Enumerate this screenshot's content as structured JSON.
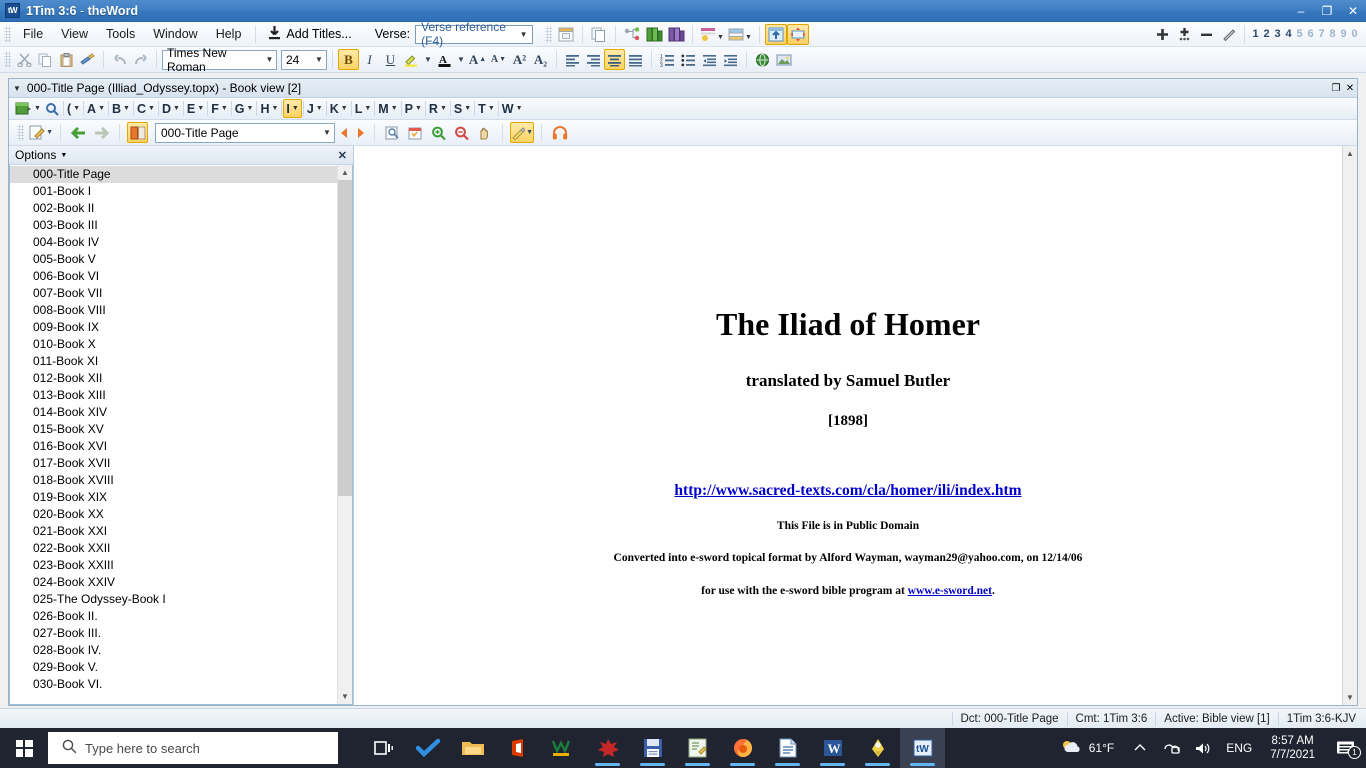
{
  "window": {
    "app_icon": "tW",
    "title_ref": "1Tim 3:6",
    "title_sep": " - ",
    "title_app": "theWord",
    "minimize": "–",
    "maximize": "❐",
    "close": "✕"
  },
  "menubar": {
    "items": [
      "File",
      "View",
      "Tools",
      "Window",
      "Help"
    ],
    "add_titles": "Add Titles...",
    "verse_label": "Verse:",
    "verse_combo_value": "Verse reference (F4)",
    "number_buttons": [
      "1",
      "2",
      "3",
      "4",
      "5",
      "6",
      "7",
      "8",
      "9",
      "0"
    ],
    "number_buttons_active": 4
  },
  "format_toolbar": {
    "font_name": "Times New Roman",
    "font_size": "24",
    "bold": "B",
    "italic": "I",
    "underline": "U",
    "font_color_letter": "A",
    "highlight_letter": "A",
    "grow_font": "A",
    "shrink_font": "A",
    "superscript": "A²",
    "subscript": "A₂"
  },
  "child_window": {
    "title": "000-Title Page (Illiad_Odyssey.topx) - Book view [2]",
    "restore": "❐",
    "close": "✕",
    "letter_buttons": [
      "(",
      "A",
      "B",
      "C",
      "D",
      "E",
      "F",
      "G",
      "H",
      "I",
      "J",
      "K",
      "L",
      "M",
      "P",
      "R",
      "S",
      "T",
      "W"
    ],
    "letter_active": "I",
    "nav_combo_value": "000-Title Page"
  },
  "left_panel": {
    "options_label": "Options",
    "close": "✕",
    "selected_index": 0,
    "items": [
      "000-Title Page",
      "001-Book I",
      "002-Book II",
      "003-Book III",
      "004-Book IV",
      "005-Book V",
      "006-Book VI",
      "007-Book VII",
      "008-Book VIII",
      "009-Book IX",
      "010-Book X",
      "011-Book XI",
      "012-Book XII",
      "013-Book XIII",
      "014-Book XIV",
      "015-Book XV",
      "016-Book XVI",
      "017-Book XVII",
      "018-Book XVIII",
      "019-Book XIX",
      "020-Book XX",
      "021-Book XXI",
      "022-Book XXII",
      "023-Book XXIII",
      "024-Book XXIV",
      "025-The Odyssey-Book I",
      "026-Book II.",
      "027-Book III.",
      "028-Book IV.",
      "029-Book V.",
      "030-Book VI."
    ]
  },
  "document": {
    "title": "The Iliad of Homer",
    "translator": "translated by Samuel Butler",
    "year": "[1898]",
    "source_link": "http://www.sacred-texts.com/cla/homer/ili/index.htm",
    "public_domain": "This File is in Public Domain",
    "converted": "Converted into e-sword topical format by Alford Wayman,  wayman29@yahoo.com, on 12/14/06",
    "for_use_prefix": "for use with the e-sword bible program at ",
    "for_use_link": "www.e-sword.net",
    "for_use_suffix": "."
  },
  "statusbar": {
    "dct": "Dct: 000-Title Page",
    "cmt": "Cmt: 1Tim 3:6",
    "active": "Active: Bible view [1]",
    "verse": "1Tim 3:6-KJV"
  },
  "taskbar": {
    "search_placeholder": "Type here to search",
    "temperature": "61°F",
    "language": "ENG",
    "time": "8:57 AM",
    "date": "7/7/2021",
    "notification_count": "1",
    "apps": [
      {
        "name": "task-view",
        "glyph": "❑"
      },
      {
        "name": "todoist",
        "glyph": "✔"
      },
      {
        "name": "file-explorer",
        "glyph": "🗀"
      },
      {
        "name": "office",
        "glyph": "O"
      },
      {
        "name": "wps",
        "glyph": "W"
      },
      {
        "name": "splat-app",
        "glyph": "✺"
      },
      {
        "name": "save-app",
        "glyph": "▤"
      },
      {
        "name": "notepad-plus",
        "glyph": "✎"
      },
      {
        "name": "firefox",
        "glyph": "◉"
      },
      {
        "name": "documents",
        "glyph": "▤"
      },
      {
        "name": "word",
        "glyph": "W"
      },
      {
        "name": "gnome-app",
        "glyph": "☗"
      },
      {
        "name": "theword",
        "glyph": "tW"
      }
    ]
  },
  "colors": {
    "accent": "#3778bd",
    "link": "#0000cc",
    "highlight": "#ffd264",
    "taskbar": "#1f2430",
    "selection": "#dcdcdc"
  }
}
